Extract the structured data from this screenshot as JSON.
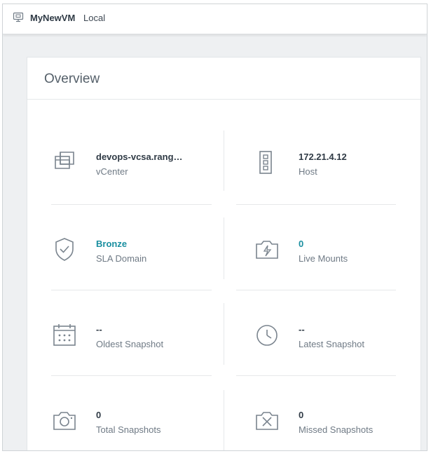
{
  "header": {
    "vm_name": "MyNewVM",
    "location": "Local",
    "icon": "vm-monitor-icon"
  },
  "overview": {
    "title": "Overview",
    "link_color": "#1a8fa0",
    "stats": [
      {
        "value": "devops-vcsa.rang…",
        "label": "vCenter",
        "icon": "vcenter-icon"
      },
      {
        "value": "172.21.4.12",
        "label": "Host",
        "icon": "host-server-icon"
      },
      {
        "value": "Bronze",
        "label": "SLA Domain",
        "icon": "shield-check-icon"
      },
      {
        "value": "0",
        "label": "Live Mounts",
        "icon": "live-mount-icon"
      },
      {
        "value": "--",
        "label": "Oldest Snapshot",
        "icon": "calendar-icon"
      },
      {
        "value": "--",
        "label": "Latest Snapshot",
        "icon": "clock-icon"
      },
      {
        "value": "0",
        "label": "Total Snapshots",
        "icon": "camera-icon"
      },
      {
        "value": "0",
        "label": "Missed Snapshots",
        "icon": "camera-missed-icon"
      }
    ]
  }
}
